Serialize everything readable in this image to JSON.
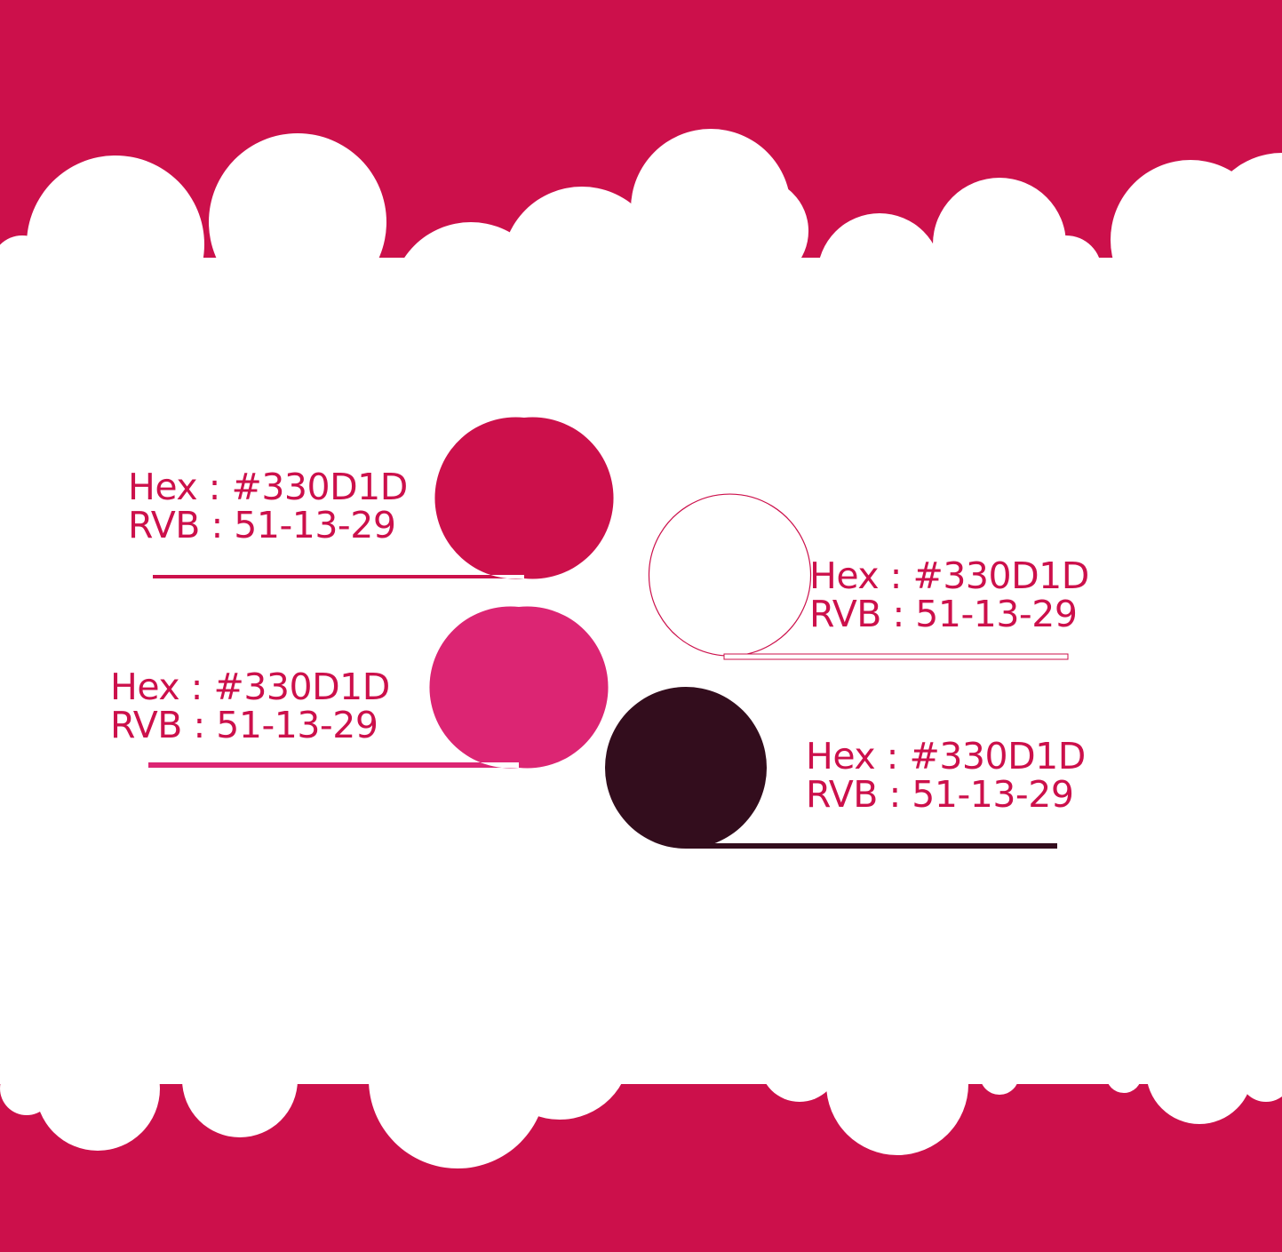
{
  "palette": {
    "brand_red": "#cc104b",
    "white": "#ffffff",
    "pink": "#dc2573",
    "dark_plum": "#330d1d"
  },
  "swatches": [
    {
      "name": "crimson",
      "color": "#cc104b",
      "hex_text": "Hex : #330D1D",
      "rvb_text": "RVB : 51-13-29"
    },
    {
      "name": "white",
      "color": "#ffffff",
      "hex_text": "Hex : #330D1D",
      "rvb_text": "RVB : 51-13-29"
    },
    {
      "name": "pink",
      "color": "#dc2573",
      "hex_text": "Hex : #330D1D",
      "rvb_text": "RVB : 51-13-29"
    },
    {
      "name": "dark-plum",
      "color": "#330d1d",
      "hex_text": "Hex : #330D1D",
      "rvb_text": "RVB : 51-13-29"
    }
  ]
}
